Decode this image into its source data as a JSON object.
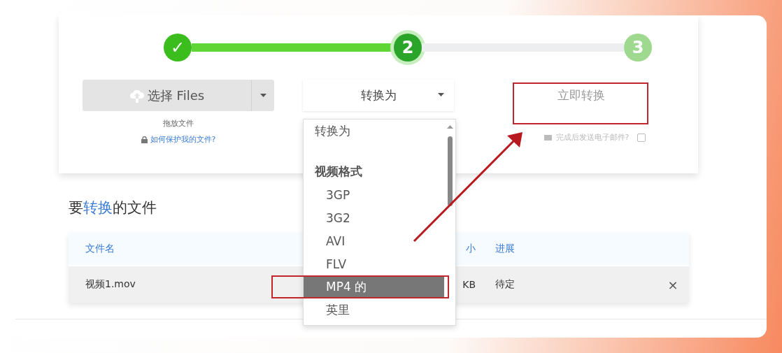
{
  "steps": [
    {
      "label": "✓",
      "done": true,
      "current": false
    },
    {
      "label": "2",
      "done": false,
      "current": true
    },
    {
      "label": "3",
      "done": false,
      "current": false
    }
  ],
  "select_button": {
    "label": "选择 Files"
  },
  "drop_hint": "拖放文件",
  "protect_link": "如何保护我的文件?",
  "convert_select": {
    "value": "转换为",
    "expanded": true
  },
  "convert_button": {
    "label": "立即转换"
  },
  "email_option": {
    "label": "完成后发送电子邮件?",
    "checked": false
  },
  "dropdown": {
    "items": [
      {
        "kind": "option",
        "label": "转换为",
        "selected": false
      },
      {
        "kind": "spacer"
      },
      {
        "kind": "group",
        "label": "视频格式"
      },
      {
        "kind": "option",
        "label": "3GP",
        "selected": false
      },
      {
        "kind": "option",
        "label": "3G2",
        "selected": false
      },
      {
        "kind": "option",
        "label": "AVI",
        "selected": false
      },
      {
        "kind": "option",
        "label": "FLV",
        "selected": false
      },
      {
        "kind": "option",
        "label": "MP4 的",
        "selected": true
      },
      {
        "kind": "option",
        "label": "英里",
        "selected": false
      }
    ]
  },
  "files_title": [
    {
      "text": "要",
      "highlight": false
    },
    {
      "text": "转换",
      "highlight": true
    },
    {
      "text": "的文件",
      "highlight": false
    }
  ],
  "table": {
    "columns": [
      "文件名",
      "小",
      "进展"
    ],
    "rows": [
      {
        "cells": [
          "视频1.mov",
          "KB",
          "待定"
        ],
        "remove": "×"
      }
    ]
  }
}
